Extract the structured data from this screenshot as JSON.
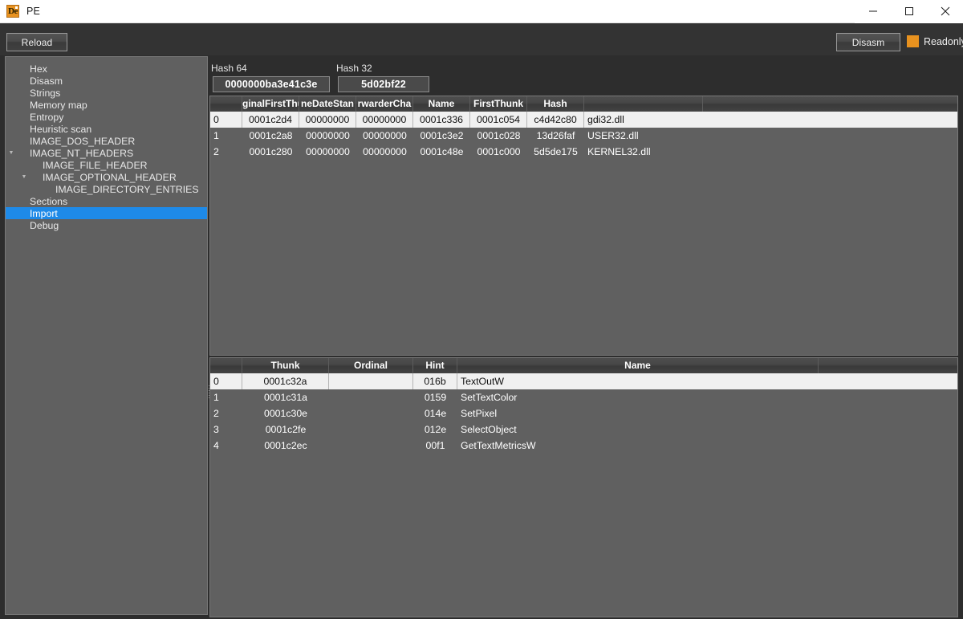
{
  "window": {
    "title": "PE",
    "icon": "die-app-icon",
    "icon_text": "De",
    "controls": {
      "minimize": "minimize-icon",
      "maximize": "maximize-icon",
      "close": "close-icon"
    }
  },
  "toolbar": {
    "reload_label": "Reload",
    "disasm_label": "Disasm",
    "readonly_label": "Readonly",
    "readonly_checked": true,
    "readonly_color": "#e8921f"
  },
  "sidebar": {
    "selected": "Import",
    "selection_color": "#1e8ae8",
    "items": [
      {
        "label": "Hex",
        "indent": 0,
        "arrow": ""
      },
      {
        "label": "Disasm",
        "indent": 0,
        "arrow": ""
      },
      {
        "label": "Strings",
        "indent": 0,
        "arrow": ""
      },
      {
        "label": "Memory map",
        "indent": 0,
        "arrow": ""
      },
      {
        "label": "Entropy",
        "indent": 0,
        "arrow": ""
      },
      {
        "label": "Heuristic scan",
        "indent": 0,
        "arrow": ""
      },
      {
        "label": "IMAGE_DOS_HEADER",
        "indent": 0,
        "arrow": ""
      },
      {
        "label": "IMAGE_NT_HEADERS",
        "indent": 0,
        "arrow": "expanded"
      },
      {
        "label": "IMAGE_FILE_HEADER",
        "indent": 1,
        "arrow": ""
      },
      {
        "label": "IMAGE_OPTIONAL_HEADER",
        "indent": 1,
        "arrow": "expanded"
      },
      {
        "label": "IMAGE_DIRECTORY_ENTRIES",
        "indent": 2,
        "arrow": ""
      },
      {
        "label": "Sections",
        "indent": 0,
        "arrow": ""
      },
      {
        "label": "Import",
        "indent": 0,
        "arrow": "",
        "selected": true
      },
      {
        "label": "Debug",
        "indent": 0,
        "arrow": ""
      }
    ]
  },
  "hashes": {
    "hash64_label": "Hash 64",
    "hash64_value": "0000000ba3e41c3e",
    "hash32_label": "Hash 32",
    "hash32_value": "5d02bf22"
  },
  "import_directory_table": {
    "columns": [
      "",
      "ginalFirstThu",
      "neDateStan",
      "rwarderCha",
      "Name",
      "FirstThunk",
      "Hash",
      ""
    ],
    "columns_full": [
      "",
      "OriginalFirstThunk",
      "TimeDateStamp",
      "ForwarderChain",
      "Name",
      "FirstThunk",
      "Hash",
      ""
    ],
    "selected_row": 0,
    "rows": [
      {
        "index": "0",
        "original_first_thunk": "0001c2d4",
        "time_date_stamp": "00000000",
        "forwarder_chain": "00000000",
        "name_rva": "0001c336",
        "first_thunk": "0001c054",
        "hash": "c4d42c80",
        "dll": "gdi32.dll"
      },
      {
        "index": "1",
        "original_first_thunk": "0001c2a8",
        "time_date_stamp": "00000000",
        "forwarder_chain": "00000000",
        "name_rva": "0001c3e2",
        "first_thunk": "0001c028",
        "hash": "13d26faf",
        "dll": "USER32.dll"
      },
      {
        "index": "2",
        "original_first_thunk": "0001c280",
        "time_date_stamp": "00000000",
        "forwarder_chain": "00000000",
        "name_rva": "0001c48e",
        "first_thunk": "0001c000",
        "hash": "5d5de175",
        "dll": "KERNEL32.dll"
      }
    ]
  },
  "import_functions_table": {
    "columns": [
      "",
      "Thunk",
      "Ordinal",
      "Hint",
      "Name"
    ],
    "selected_row": 0,
    "rows": [
      {
        "index": "0",
        "thunk": "0001c32a",
        "ordinal": "",
        "hint": "016b",
        "name": "TextOutW"
      },
      {
        "index": "1",
        "thunk": "0001c31a",
        "ordinal": "",
        "hint": "0159",
        "name": "SetTextColor"
      },
      {
        "index": "2",
        "thunk": "0001c30e",
        "ordinal": "",
        "hint": "014e",
        "name": "SetPixel"
      },
      {
        "index": "3",
        "thunk": "0001c2fe",
        "ordinal": "",
        "hint": "012e",
        "name": "SelectObject"
      },
      {
        "index": "4",
        "thunk": "0001c2ec",
        "ordinal": "",
        "hint": "00f1",
        "name": "GetTextMetricsW"
      }
    ]
  }
}
